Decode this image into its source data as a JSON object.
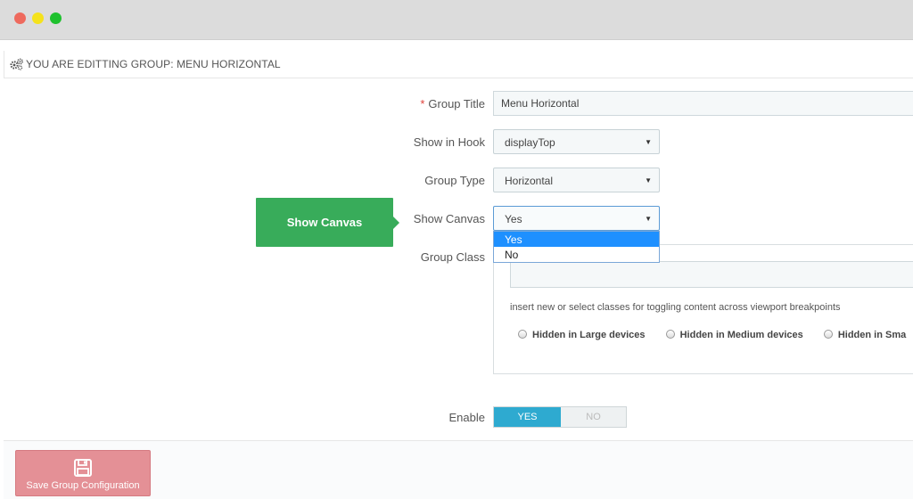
{
  "window": {
    "controls": [
      "close",
      "minimize",
      "maximize"
    ],
    "colors": {
      "close": "#ee6a5e",
      "minimize": "#f5e21c",
      "maximize": "#1fc12e"
    }
  },
  "panel": {
    "heading": "YOU ARE EDITTING GROUP: MENU HORIZONTAL",
    "heading_icon": "gears-icon"
  },
  "form": {
    "group_title": {
      "label": "Group Title",
      "required_mark": "*",
      "value": "Menu Horizontal"
    },
    "show_in_hook": {
      "label": "Show in Hook",
      "value": "displayTop"
    },
    "group_type": {
      "label": "Group Type",
      "value": "Horizontal"
    },
    "show_canvas": {
      "label": "Show Canvas",
      "value": "Yes",
      "options": [
        "Yes",
        "No"
      ],
      "highlighted": "Yes"
    },
    "group_class": {
      "label": "Group Class",
      "value": "",
      "help": "insert new or select classes for toggling content across viewport breakpoints",
      "options": [
        "Hidden in Large devices",
        "Hidden in Medium devices",
        "Hidden in Sma"
      ]
    },
    "enable": {
      "label": "Enable",
      "yes": "YES",
      "no": "NO",
      "selected": "YES"
    }
  },
  "callout": {
    "text": "Show Canvas",
    "color": "#38ac5a"
  },
  "footer": {
    "save_label": "Save Group Configuration",
    "save_icon": "floppy-disk-icon",
    "color": "#e49096"
  },
  "colors": {
    "toggle_active": "#2eaad0",
    "dropdown_highlight": "#1e90ff",
    "required": "#e0413a"
  }
}
